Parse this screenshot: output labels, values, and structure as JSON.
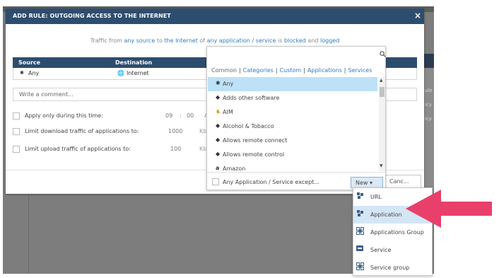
{
  "background": {
    "side_texts": [
      "ule",
      "icy",
      "icy"
    ]
  },
  "modal": {
    "title": "ADD RULE: OUTGOING ACCESS TO THE INTERNET",
    "close_glyph": "×",
    "summary": {
      "p1": "Traffic from ",
      "source": "any source",
      "p2": " to ",
      "destination": "the Internet",
      "p3": " of ",
      "application": "any application / service",
      "p4": " is ",
      "action": "blocked",
      "p5": " and ",
      "log": "logged"
    },
    "table": {
      "headers": [
        "Source",
        "Destination"
      ],
      "source_value": "Any",
      "source_icon": "✱",
      "destination_value": "Internet",
      "destination_icon": "🌐"
    },
    "comment_placeholder": "Write a comment...",
    "options": {
      "time": {
        "label": "Apply only during this time:",
        "hour": "09",
        "colon": ":",
        "minute": "00",
        "partial": "A"
      },
      "download": {
        "label": "Limit download traffic of applications to:",
        "value": "1000",
        "unit": "Kbp:"
      },
      "upload": {
        "label": "Limit upload traffic of applications to:",
        "value": "100",
        "unit": "Kbp:"
      }
    },
    "cancel_label": "Canc..."
  },
  "dropdown": {
    "search_icon": "🔍",
    "tabs": {
      "common": "Common",
      "categories": "Categories",
      "custom": "Custom",
      "applications": "Applications",
      "services": "Services",
      "separator": "|"
    },
    "items": [
      {
        "label": "Any",
        "icon": "✱",
        "selected": true
      },
      {
        "label": "Adds other software",
        "icon": "◆"
      },
      {
        "label": "AIM",
        "icon": "♞"
      },
      {
        "label": "Alcohol & Tobacco",
        "icon": "◆"
      },
      {
        "label": "Allows remote connect",
        "icon": "◆"
      },
      {
        "label": "Allows remote control",
        "icon": "◆"
      },
      {
        "label": "Amazon",
        "icon": "a"
      }
    ],
    "scroll_up": "▲",
    "scroll_down": "▼",
    "except_label": "Any Application / Service except...",
    "new_button": "New ▾"
  },
  "new_menu": {
    "items": [
      {
        "label": "URL",
        "icon": "puzzle-icon"
      },
      {
        "label": "Application",
        "icon": "puzzle-icon",
        "highlighted": true
      },
      {
        "label": "Applications Group",
        "icon": "group-icon"
      },
      {
        "label": "Service",
        "icon": "service-icon"
      },
      {
        "label": "Service group",
        "icon": "group-icon"
      }
    ]
  },
  "colors": {
    "header": "#2d4d6f",
    "link": "#2f7cc2",
    "selected_item": "#bde1f7",
    "menu_highlight": "#d4e6f6",
    "arrow": "#e8406a",
    "overlay": "#7d7d7d"
  }
}
